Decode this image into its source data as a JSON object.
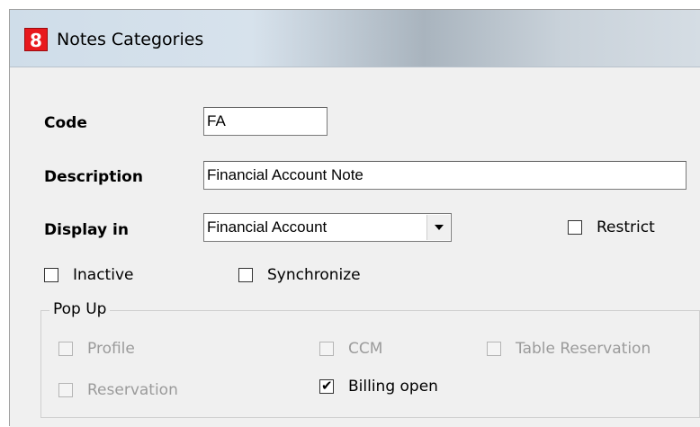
{
  "window": {
    "title": "Notes Categories",
    "icon_glyph": "8",
    "icon_color": "#e8191d"
  },
  "form": {
    "code_label": "Code",
    "code_value": "FA",
    "description_label": "Description",
    "description_value": "Financial Account Note",
    "display_in_label": "Display in",
    "display_in_value": "Financial Account",
    "restrict_label": "Restrict",
    "restrict_checked": false,
    "inactive_label": "Inactive",
    "inactive_checked": false,
    "synchronize_label": "Synchronize",
    "synchronize_checked": false
  },
  "popup": {
    "legend": "Pop Up",
    "profile_label": "Profile",
    "profile_checked": false,
    "ccm_label": "CCM",
    "ccm_checked": false,
    "table_reservation_label": "Table Reservation",
    "table_reservation_checked": false,
    "reservation_label": "Reservation",
    "reservation_checked": false,
    "billing_open_label": "Billing open",
    "billing_open_checked": true
  }
}
